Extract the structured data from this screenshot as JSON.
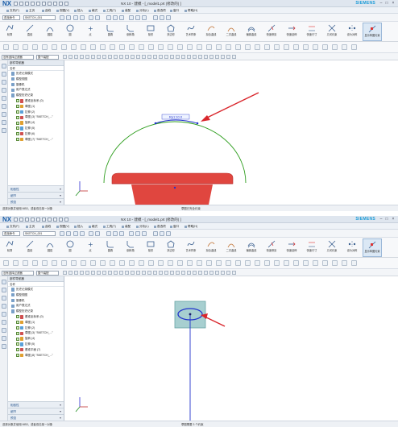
{
  "panels": [
    {
      "window_title": "NX 10 - 建模 - [_model1.prt  (修改的) ]",
      "brand": "SIEMENS",
      "menu": [
        "文件(F)",
        "主页",
        "曲线",
        "视图(V)",
        "插入",
        "格式",
        "工具(T)",
        "装配",
        "分析(L)",
        "首选项",
        "窗口",
        "帮助(H)"
      ],
      "command_finder_value": "查找命令",
      "filter_value": "SKETCH_001",
      "ribbon": [
        "轮廓",
        "直线",
        "圆弧",
        "圆",
        "点",
        "圆角",
        "倒斜角",
        "矩形",
        "多边形",
        "艺术样条",
        "拟合曲线",
        "二次曲线",
        "偏置曲线",
        "快速修剪",
        "快速延伸",
        "快速尺寸",
        "几何约束",
        "设为对称",
        "显示草图约束"
      ],
      "selection_filter": "没有选择过滤器",
      "scope": "整个装配",
      "navigator": {
        "title": "部件导航器",
        "column": "名称",
        "nodes": [
          {
            "label": "历史记录模式"
          },
          {
            "label": "模型视图"
          },
          {
            "label": "摄像机"
          },
          {
            "label": "用户表达式"
          },
          {
            "label": "模型历史记录"
          },
          {
            "label": "基准坐标系 (0)"
          },
          {
            "label": "草图 (1)"
          },
          {
            "label": "拉伸 (2)"
          },
          {
            "label": "草图 (3) \"SKETCH_...\""
          },
          {
            "label": "旋转 (4)"
          },
          {
            "label": "拉伸 (5)"
          },
          {
            "label": "拉伸 (6)"
          },
          {
            "label": "草图 (7) \"SKETCH_...\""
          }
        ],
        "sections": [
          "相依性",
          "细节",
          "预览"
        ]
      },
      "dimension_label": "Rp1:10.0",
      "status_left": "选择对象并使用 MB3，或者双击某一对象",
      "status_right": "草图已完全约束"
    },
    {
      "window_title": "NX 10 - 建模 - [_model1.prt  (修改的) ]",
      "brand": "SIEMENS",
      "menu": [
        "文件(F)",
        "主页",
        "曲线",
        "视图(V)",
        "插入",
        "格式",
        "工具(T)",
        "装配",
        "分析(L)",
        "首选项",
        "窗口",
        "帮助(H)"
      ],
      "command_finder_value": "查找命令",
      "filter_value": "SKETCH_001",
      "ribbon": [
        "轮廓",
        "直线",
        "圆弧",
        "圆",
        "点",
        "圆角",
        "倒斜角",
        "矩形",
        "多边形",
        "艺术样条",
        "拟合曲线",
        "二次曲线",
        "偏置曲线",
        "快速修剪",
        "快速延伸",
        "快速尺寸",
        "几何约束",
        "设为对称",
        "显示草图约束"
      ],
      "selection_filter": "没有选择过滤器",
      "scope": "整个装配",
      "navigator": {
        "title": "部件导航器",
        "column": "名称",
        "nodes": [
          {
            "label": "历史记录模式"
          },
          {
            "label": "模型视图"
          },
          {
            "label": "摄像机"
          },
          {
            "label": "用户表达式"
          },
          {
            "label": "模型历史记录"
          },
          {
            "label": "基准坐标系 (0)"
          },
          {
            "label": "草图 (1)"
          },
          {
            "label": "拉伸 (2)"
          },
          {
            "label": "草图 (3) \"SKETCH_...\""
          },
          {
            "label": "旋转 (4)"
          },
          {
            "label": "拉伸 (5)"
          },
          {
            "label": "基准平面 (7)"
          },
          {
            "label": "草图 (8) \"SKETCH_...\""
          }
        ],
        "sections": [
          "相依性",
          "细节",
          "预览"
        ]
      },
      "status_left": "选择对象并使用 MB3，或者双击某一对象",
      "status_right": "草图需要 3 个约束"
    }
  ],
  "colors": {
    "accent": "#1b5ea8",
    "brand": "#1a9bd7",
    "arc": "#2f9e1f",
    "bucket": "#e0463f",
    "bucket_dark": "#b92d2a",
    "highlight_arrow": "#d9262c",
    "sketch_blue": "#2233cc",
    "plane": "#a7cfd0"
  }
}
